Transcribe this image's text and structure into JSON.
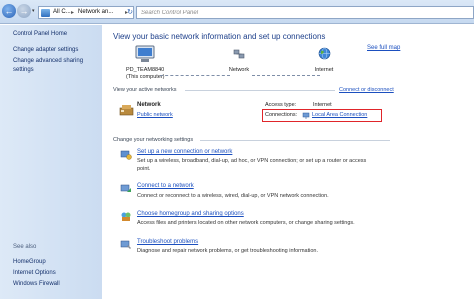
{
  "address": {
    "crumbs": [
      "All C...",
      "Network an...",
      "▸"
    ],
    "separator": "▸",
    "search_placeholder": "Search Control Panel",
    "back_icon": "back-arrow-icon",
    "forward_icon": "forward-arrow-icon"
  },
  "sidebar": {
    "items": [
      {
        "label": "Control Panel Home"
      },
      {
        "label": "Change adapter settings"
      },
      {
        "label": "Change advanced sharing"
      },
      {
        "label": "settings"
      }
    ],
    "see_also_label": "See also",
    "see_also": [
      {
        "label": "HomeGroup"
      },
      {
        "label": "Internet Options"
      },
      {
        "label": "Windows Firewall"
      }
    ]
  },
  "main": {
    "heading": "View your basic network information and set up connections",
    "see_full_map": "See full map",
    "map": {
      "computer_name": "PD_TEAM8840",
      "computer_sub": "(This computer)",
      "network_label": "Network",
      "internet_label": "Internet"
    },
    "active_networks_label": "View your active networks",
    "connect_or_disconnect": "Connect or disconnect",
    "network": {
      "name": "Network",
      "type": "Public network",
      "access_type_label": "Access type:",
      "access_type_value": "Internet",
      "connections_label": "Connections:",
      "connection_value": "Local Area Connection"
    },
    "change_settings_label": "Change your networking settings",
    "tasks": [
      {
        "title": "Set up a new connection or network",
        "desc1": "Set up a wireless, broadband, dial-up, ad hoc, or VPN connection; or set up a router or access",
        "desc2": "point."
      },
      {
        "title": "Connect to a network",
        "desc1": "Connect or reconnect to a wireless, wired, dial-up, or VPN network connection.",
        "desc2": ""
      },
      {
        "title": "Choose homegroup and sharing options",
        "desc1": "Access files and printers located on other network computers, or change sharing settings.",
        "desc2": ""
      },
      {
        "title": "Troubleshoot problems",
        "desc1": "Diagnose and repair network problems, or get troubleshooting information.",
        "desc2": ""
      }
    ]
  },
  "colors": {
    "link": "#1b4fbf",
    "heading": "#1d3f8a",
    "highlight": "#e0252a",
    "sidebar_bg": "#d4e3f5"
  }
}
